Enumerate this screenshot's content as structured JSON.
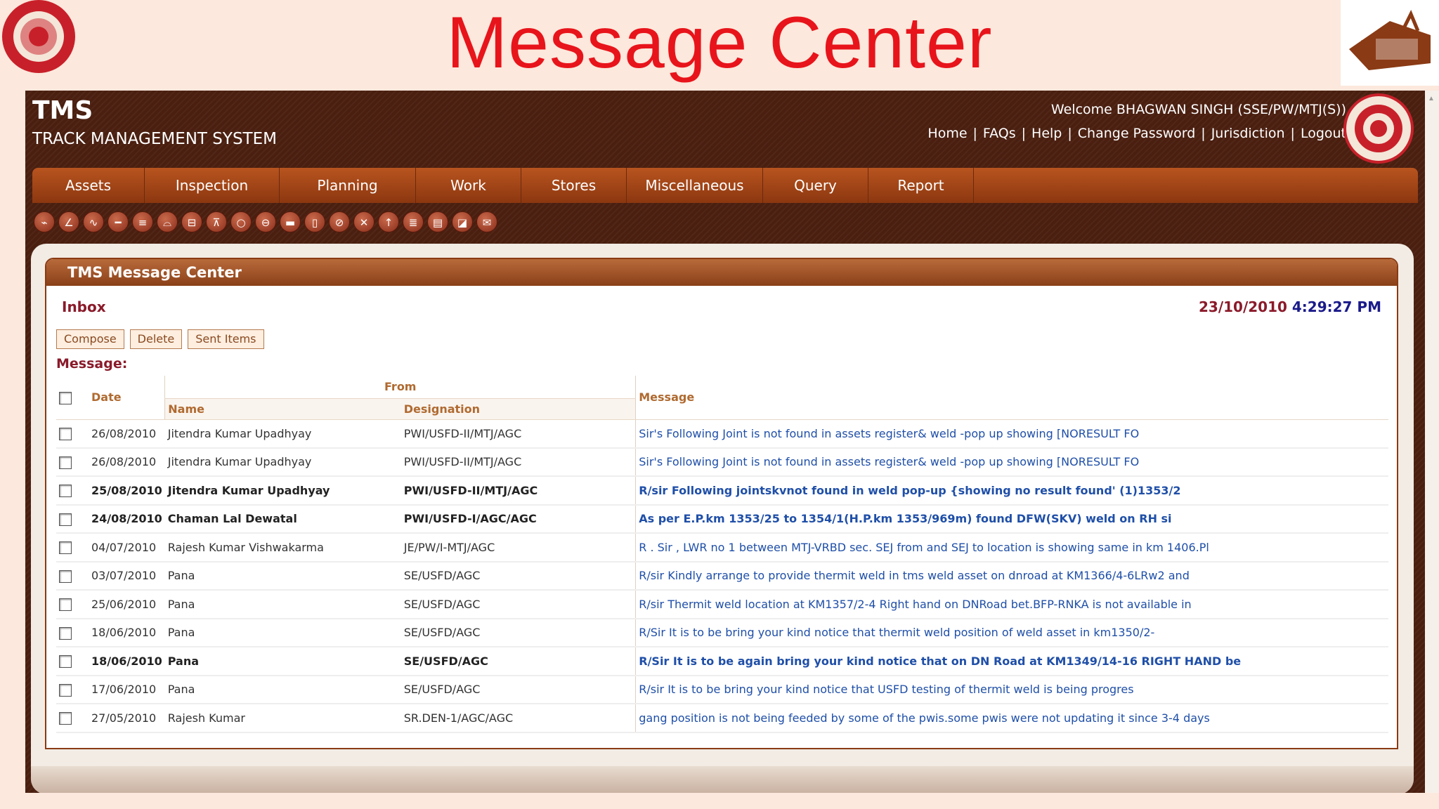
{
  "slide": {
    "title": "Message Center"
  },
  "app": {
    "title": "TMS",
    "subtitle": "TRACK MANAGEMENT SYSTEM",
    "welcome": "Welcome BHAGWAN SINGH (SSE/PW/MTJ(S))",
    "links": [
      "Home",
      "FAQs",
      "Help",
      "Change Password",
      "Jurisdiction",
      "Logout"
    ]
  },
  "menu": [
    "Assets",
    "Inspection",
    "Planning",
    "Work",
    "Stores",
    "Miscellaneous",
    "Query",
    "Report"
  ],
  "toolbar_icons": [
    "track-icon",
    "curve-icon",
    "wave-icon",
    "rail-icon",
    "sleeper-icon",
    "bridge-icon",
    "lever-icon",
    "signal-icon",
    "circle-icon",
    "crossing-icon",
    "bar-icon",
    "document-icon",
    "tool-icon",
    "wrench-icon",
    "marker-icon",
    "chart-icon",
    "book-icon",
    "chat-icon",
    "mail-icon"
  ],
  "panel": {
    "title": "TMS Message Center",
    "inbox_label": "Inbox",
    "date": "23/10/2010",
    "time": "4:29:27 PM",
    "buttons": {
      "compose": "Compose",
      "delete": "Delete",
      "sent": "Sent Items"
    },
    "message_label": "Message:"
  },
  "table": {
    "headers": {
      "date": "Date",
      "from": "From",
      "name": "Name",
      "designation": "Designation",
      "message": "Message"
    },
    "rows": [
      {
        "date": "26/08/2010",
        "name": "Jitendra Kumar Upadhyay",
        "designation": "PWI/USFD-II/MTJ/AGC",
        "message": "Sir's Following Joint is not found in assets register& weld -pop up showing [NORESULT FO",
        "unread": false
      },
      {
        "date": "26/08/2010",
        "name": "Jitendra Kumar Upadhyay",
        "designation": "PWI/USFD-II/MTJ/AGC",
        "message": "Sir's Following Joint is not found in assets register& weld -pop up showing [NORESULT FO",
        "unread": false
      },
      {
        "date": "25/08/2010",
        "name": "Jitendra Kumar Upadhyay",
        "designation": "PWI/USFD-II/MTJ/AGC",
        "message": "R/sir Following jointskvnot found in weld pop-up {showing no result found' (1)1353/2",
        "unread": true
      },
      {
        "date": "24/08/2010",
        "name": "Chaman Lal Dewatal",
        "designation": "PWI/USFD-I/AGC/AGC",
        "message": "As per E.P.km 1353/25 to 1354/1(H.P.km 1353/969m) found DFW(SKV) weld on RH si",
        "unread": true
      },
      {
        "date": "04/07/2010",
        "name": "Rajesh Kumar Vishwakarma",
        "designation": "JE/PW/I-MTJ/AGC",
        "message": "R . Sir , LWR no 1 between MTJ-VRBD sec. SEJ from and SEJ to location is showing same in km 1406.Pl",
        "unread": false
      },
      {
        "date": "03/07/2010",
        "name": "Pana",
        "designation": "SE/USFD/AGC",
        "message": "R/sir Kindly arrange to provide thermit weld in tms weld asset on dnroad at KM1366/4-6LRw2 and",
        "unread": false
      },
      {
        "date": "25/06/2010",
        "name": "Pana",
        "designation": "SE/USFD/AGC",
        "message": "R/sir Thermit weld location at KM1357/2-4 Right hand on DNRoad bet.BFP-RNKA is not available in",
        "unread": false
      },
      {
        "date": "18/06/2010",
        "name": "Pana",
        "designation": "SE/USFD/AGC",
        "message": "R/Sir It is to be bring your kind notice that thermit weld position of weld asset in km1350/2-",
        "unread": false
      },
      {
        "date": "18/06/2010",
        "name": "Pana",
        "designation": "SE/USFD/AGC",
        "message": "R/Sir It is to be again bring your kind notice that on DN Road at KM1349/14-16 RIGHT HAND be",
        "unread": true
      },
      {
        "date": "17/06/2010",
        "name": "Pana",
        "designation": "SE/USFD/AGC",
        "message": "R/sir It is to be bring your kind notice that USFD testing of thermit weld is being progres",
        "unread": false
      },
      {
        "date": "27/05/2010",
        "name": "Rajesh Kumar",
        "designation": "SR.DEN-1/AGC/AGC",
        "message": "gang position is not being feeded by some of the pwis.some pwis were not updating it since 3-4 days",
        "unread": false
      }
    ]
  }
}
